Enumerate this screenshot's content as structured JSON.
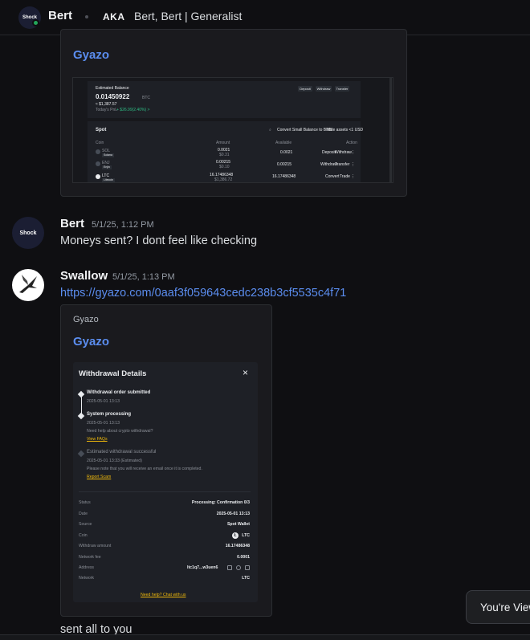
{
  "header": {
    "name": "Bert",
    "avatar_text": "Shock",
    "aka_label": "AKA",
    "aka_names": "Bert, Bert | Generalist"
  },
  "embed1": {
    "title": "Gyazo",
    "screenshot": {
      "balance_label": "Estimated Balance",
      "balance_value": "0.01450922",
      "balance_unit": "BTC",
      "balance_fiat": "≈ $1,387.57",
      "pnl_label": "Today's PnL",
      "pnl_value": "+ $26.99(2.40%) >",
      "btn_deposit": "Deposit",
      "btn_withdraw": "Withdraw",
      "btn_transfer": "Transfer",
      "spot_label": "Spot",
      "convert_label": "Convert Small Balance to BNB",
      "hide_label": "Hide assets <1 USD",
      "col_coin": "Coin",
      "col_amount": "Amount",
      "col_available": "Available",
      "col_action": "Action",
      "rows": [
        {
          "coin": "SOL",
          "badge": "Solana",
          "amount": "0.0021",
          "sub": "$0.31",
          "available": "0.0021",
          "actions": [
            "Deposit",
            "Withdraw"
          ]
        },
        {
          "coin": "ENJ",
          "badge": "Enjin",
          "amount": "0.00215",
          "sub": "$0.10",
          "available": "0.00215",
          "actions": [
            "Withdraw",
            "Transfer"
          ]
        },
        {
          "coin": "LTC",
          "badge": "Litecoin",
          "amount": "16.17486348",
          "sub": "$1,386.72",
          "available": "16.17486348",
          "actions": [
            "Convert",
            "Trade"
          ]
        }
      ]
    }
  },
  "message_bert": {
    "author": "Bert",
    "avatar_text": "Shock",
    "timestamp": "5/1/25, 1:12 PM",
    "text": "Moneys sent? I dont feel like checking"
  },
  "message_swallow": {
    "author": "Swallow",
    "timestamp": "5/1/25, 1:13 PM",
    "link": "https://gyazo.com/0aaf3f059643cedc238b3cf5535c4f71",
    "embed_provider": "Gyazo",
    "embed_title": "Gyazo"
  },
  "withdrawal": {
    "title": "Withdrawal Details",
    "close": "×",
    "steps": [
      {
        "title": "Withdrawal order submitted",
        "time": "2025-05-01 13:13"
      },
      {
        "title": "System processing",
        "time": "2025-05-01 13:13",
        "note": "Need help about crypto withdrawal?",
        "link": "View FAQs"
      },
      {
        "title": "Estimated withdrawal successful",
        "time": "2025-05-01 13:33 (Estimated)",
        "note": "Please note that you will receive an email once it is completed.",
        "link": "Report Scam"
      }
    ],
    "details": [
      {
        "label": "Status",
        "value": "Processing: Confirmation 0/3"
      },
      {
        "label": "Date",
        "value": "2025-05-01 13:13"
      },
      {
        "label": "Source",
        "value": "Spot Wallet"
      },
      {
        "label": "Coin",
        "value": "LTC"
      },
      {
        "label": "Withdraw amount",
        "value": "16.17486348"
      },
      {
        "label": "Network fee",
        "value": "0.0001"
      },
      {
        "label": "Address",
        "value": "ltc1q7...w3uen6"
      },
      {
        "label": "Network",
        "value": "LTC"
      }
    ],
    "help_link": "Need help? Chat with us"
  },
  "message_swallow_2": {
    "text": "sent all to you"
  },
  "toast": {
    "text": "You're View"
  }
}
